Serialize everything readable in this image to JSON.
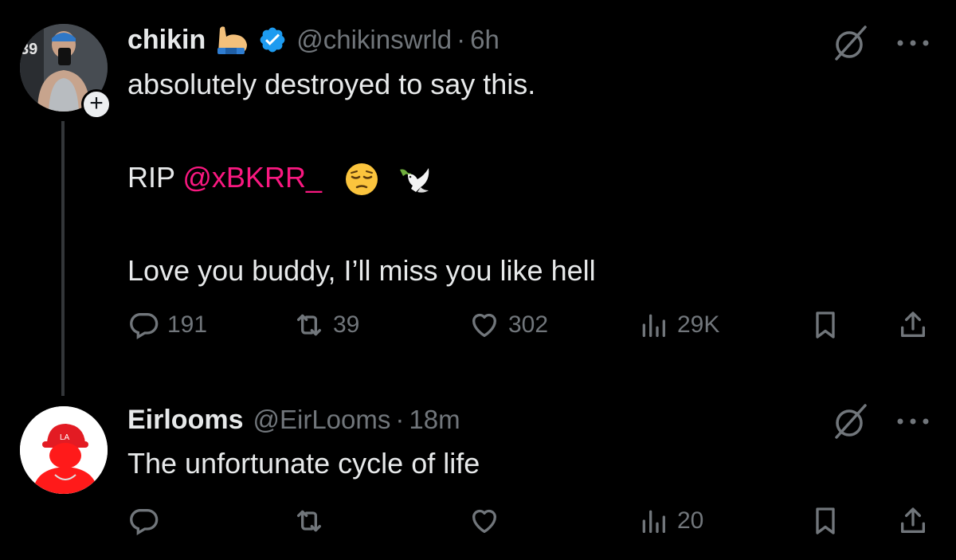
{
  "colors": {
    "background": "#000000",
    "text": "#e7e9ea",
    "muted": "#71767b",
    "verified": "#1d9bf0",
    "mention": "#f91880",
    "thread_line": "#333639"
  },
  "tweets": [
    {
      "author": {
        "display_name": "chikin",
        "handle": "@chikinswrld",
        "time": "6h",
        "verified": true,
        "badge_emoji": "flexed-biceps"
      },
      "lines": {
        "first": "absolutely destroyed to say this.",
        "rip_prefix": "RIP ",
        "mention": "@xBKRR_",
        "emojis": [
          "pensive-face",
          "dove"
        ],
        "last": "Love you buddy, I’ll miss you like hell"
      },
      "stats": {
        "replies": "191",
        "reposts": "39",
        "likes": "302",
        "views": "29K"
      }
    },
    {
      "author": {
        "display_name": "Eirlooms",
        "handle": "@EirLooms",
        "time": "18m",
        "verified": false
      },
      "lines": {
        "first": "The unfortunate cycle of life"
      },
      "stats": {
        "replies": "",
        "reposts": "",
        "likes": "",
        "views": "20"
      }
    }
  ],
  "separator": "·",
  "follow_label": "+"
}
